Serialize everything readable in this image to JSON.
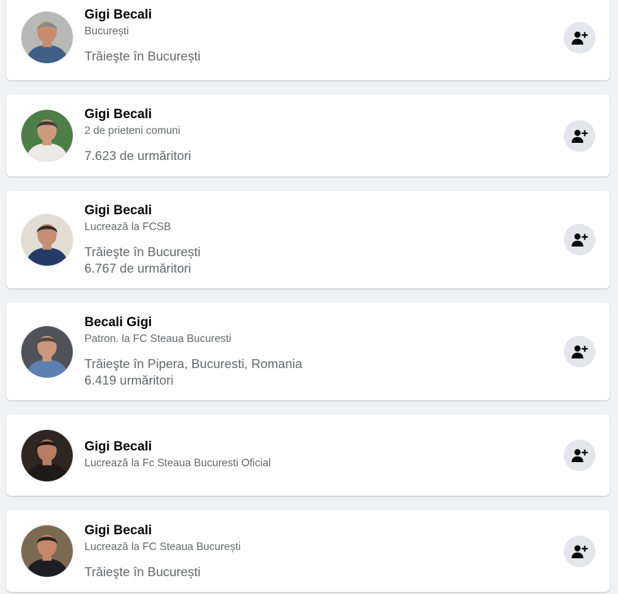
{
  "results": [
    {
      "name": "Gigi Becali",
      "subtitle": "București",
      "details": [
        "Trăieşte în București"
      ],
      "add_friend_icon": "add-friend-icon",
      "avatar_colors": {
        "bg": "#b7b9b6",
        "skin": "#c78c6d",
        "hair": "#8a8a88",
        "shirt": "#3f5f86"
      }
    },
    {
      "name": "Gigi Becali",
      "subtitle": "2 de prieteni comuni",
      "details": [
        "7.623 de urmăritori"
      ],
      "add_friend_icon": "add-friend-icon",
      "avatar_colors": {
        "bg": "#4d7e48",
        "skin": "#cc9a7d",
        "hair": "#3d3b39",
        "shirt": "#eceae5"
      }
    },
    {
      "name": "Gigi Becali",
      "subtitle": "Lucrează la FCSB",
      "details": [
        "Trăieşte în București",
        "6.767 de urmăritori"
      ],
      "add_friend_icon": "add-friend-icon",
      "avatar_colors": {
        "bg": "#e1ddd3",
        "skin": "#c48f74",
        "hair": "#2f2d2b",
        "shirt": "#253a66"
      }
    },
    {
      "name": "Becali Gigi",
      "subtitle": "Patron. la FC Steaua Bucuresti",
      "details": [
        "Trăieşte în Pipera, Bucuresti, Romania",
        "6.419 urmăritori"
      ],
      "add_friend_icon": "add-friend-icon",
      "avatar_colors": {
        "bg": "#4f5358",
        "skin": "#c9977b",
        "hair": "#4e4b48",
        "shirt": "#5d7fb1"
      }
    },
    {
      "name": "Gigi Becali",
      "subtitle": "Lucrează la Fc Steaua Bucuresti Oficial",
      "details": [],
      "add_friend_icon": "add-friend-icon",
      "avatar_colors": {
        "bg": "#2e2623",
        "skin": "#b87c62",
        "hair": "#1c1715",
        "shirt": "#1d1a19"
      }
    },
    {
      "name": "Gigi Becali",
      "subtitle": "Lucrează la FC Steaua București",
      "details": [
        "Trăieşte în București"
      ],
      "add_friend_icon": "add-friend-icon",
      "avatar_colors": {
        "bg": "#7b6a52",
        "skin": "#c48769",
        "hair": "#252120",
        "shirt": "#1e1d22"
      }
    }
  ],
  "colors": {
    "page_bg": "#f0f2f5",
    "card_bg": "#ffffff",
    "name": "#050505",
    "secondary": "#65676b",
    "button_bg": "#e4e6eb",
    "icon": "#050505"
  }
}
